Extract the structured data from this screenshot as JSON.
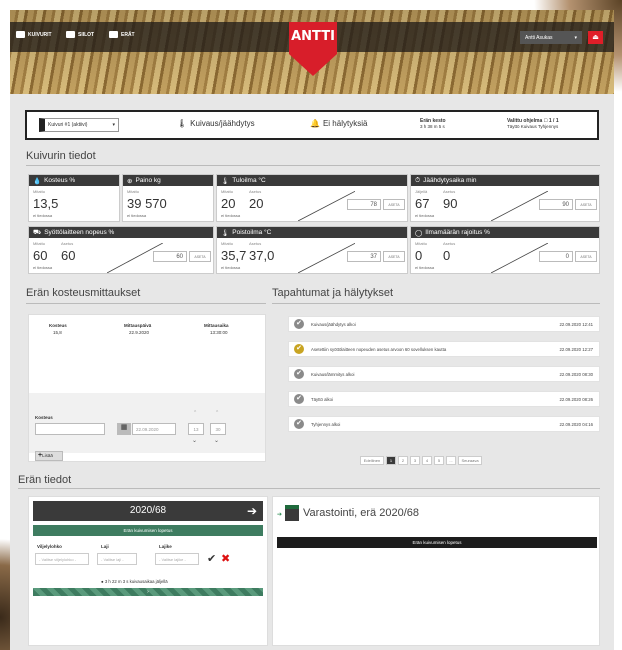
{
  "nav": {
    "kuivurit": "KUIVURIT",
    "siilot": "SIILOT",
    "erat": "ERÄT",
    "user": "Antti Asukas",
    "logo": "ANTTI",
    "logout_icon": "logout-icon"
  },
  "info": {
    "dryer": "Kuivuri #1 (aktiivi)",
    "mode": "Kuivaus/jäähdytys",
    "alarms": "Ei hälytyksiä",
    "time_label": "Erän kesto",
    "time_value": "3 h 38 m 5 s",
    "target_label": "Valittu ohjelma",
    "target_value": "1 / 1",
    "target_sub": "Täyttö Kuivaus Tyhjennys"
  },
  "section_dryer": "Kuivurin tiedot",
  "cards": [
    {
      "title": "Kosteus %",
      "lbl": "Mitattu",
      "val": "13,5",
      "tag": "ei tiedossa"
    },
    {
      "title": "Paino kg",
      "lbl": "Mitattu",
      "val": "39 570",
      "tag": "ei tiedossa"
    },
    {
      "title": "Tuloilma °C",
      "lbl": "Mitattu",
      "lbl2": "Asetus",
      "val": "20",
      "val2": "20",
      "input": "78",
      "btn": "ASETA",
      "tag": "ei tiedossa"
    },
    {
      "title": "Jäähdytysaika min",
      "lbl": "Jäljellä",
      "lbl2": "Asetus",
      "val": "67",
      "val2": "90",
      "input": "90",
      "btn": "ASETA",
      "tag": "ei tiedossa"
    },
    {
      "title": "Syöttölaitteen nopeus %",
      "lbl": "Mitattu",
      "lbl2": "Asetus",
      "val": "60",
      "val2": "60",
      "input": "60",
      "btn": "ASETA",
      "tag": "ei tiedossa"
    },
    {
      "title": "Poistoilma °C",
      "lbl": "Mitattu",
      "lbl2": "Asetus",
      "val": "35,7",
      "val2": "37,0",
      "input": "37",
      "btn": "ASETA",
      "tag": "ei tiedossa"
    },
    {
      "title": "Ilmamäärän rajoitus %",
      "lbl": "Mitattu",
      "lbl2": "Asetus",
      "val": "0",
      "val2": "0",
      "input": "0",
      "btn": "ASETA",
      "tag": "ei tiedossa"
    }
  ],
  "moisture": {
    "title": "Erän kosteusmittaukset",
    "cols": [
      "Kosteus",
      "Mittauspäivä",
      "Mittausaika"
    ],
    "row": [
      "15,8",
      "22.9.2020",
      "13:30:00"
    ],
    "input_label": "Kosteus",
    "date": "22.09.2020",
    "hh": "13",
    "mm": "30",
    "add": "Lisää"
  },
  "events": {
    "title": "Tapahtumat ja hälytykset",
    "items": [
      {
        "text": "Kuivaus/jäähdytys alkoi",
        "date": "22.09.2020 12:41"
      },
      {
        "text": "Asetettiin syöttölaitteen nopeuden asetus arvoon 60 sovelluksen kautta",
        "date": "22.09.2020 12:27"
      },
      {
        "text": "Kuivaus/lämmitys alkoi",
        "date": "22.09.2020 08:30"
      },
      {
        "text": "Täyttö alkoi",
        "date": "22.09.2020 08:26"
      },
      {
        "text": "Tyhjennys alkoi",
        "date": "22.09.2020 04:16"
      }
    ],
    "pager": [
      "Edellinen",
      "1",
      "2",
      "3",
      "4",
      "5",
      "...",
      "Seuraava"
    ]
  },
  "batch": {
    "title": "Erän tiedot",
    "id": "2020/68",
    "btn_end": "Erän kuivumisen lopetus",
    "cols": [
      "Viljelylohko",
      "Laji",
      "Lajike"
    ],
    "ph": [
      "- Valitse viljelylohko -",
      "- Valitse laji -",
      "- Valitse lajike -"
    ],
    "note": "3 h 22 m 3 s kuivausaikaa jäljellä",
    "storage": "Varastointi, erä 2020/68",
    "storage_btn": "Erän kuivumisen lopetus"
  }
}
